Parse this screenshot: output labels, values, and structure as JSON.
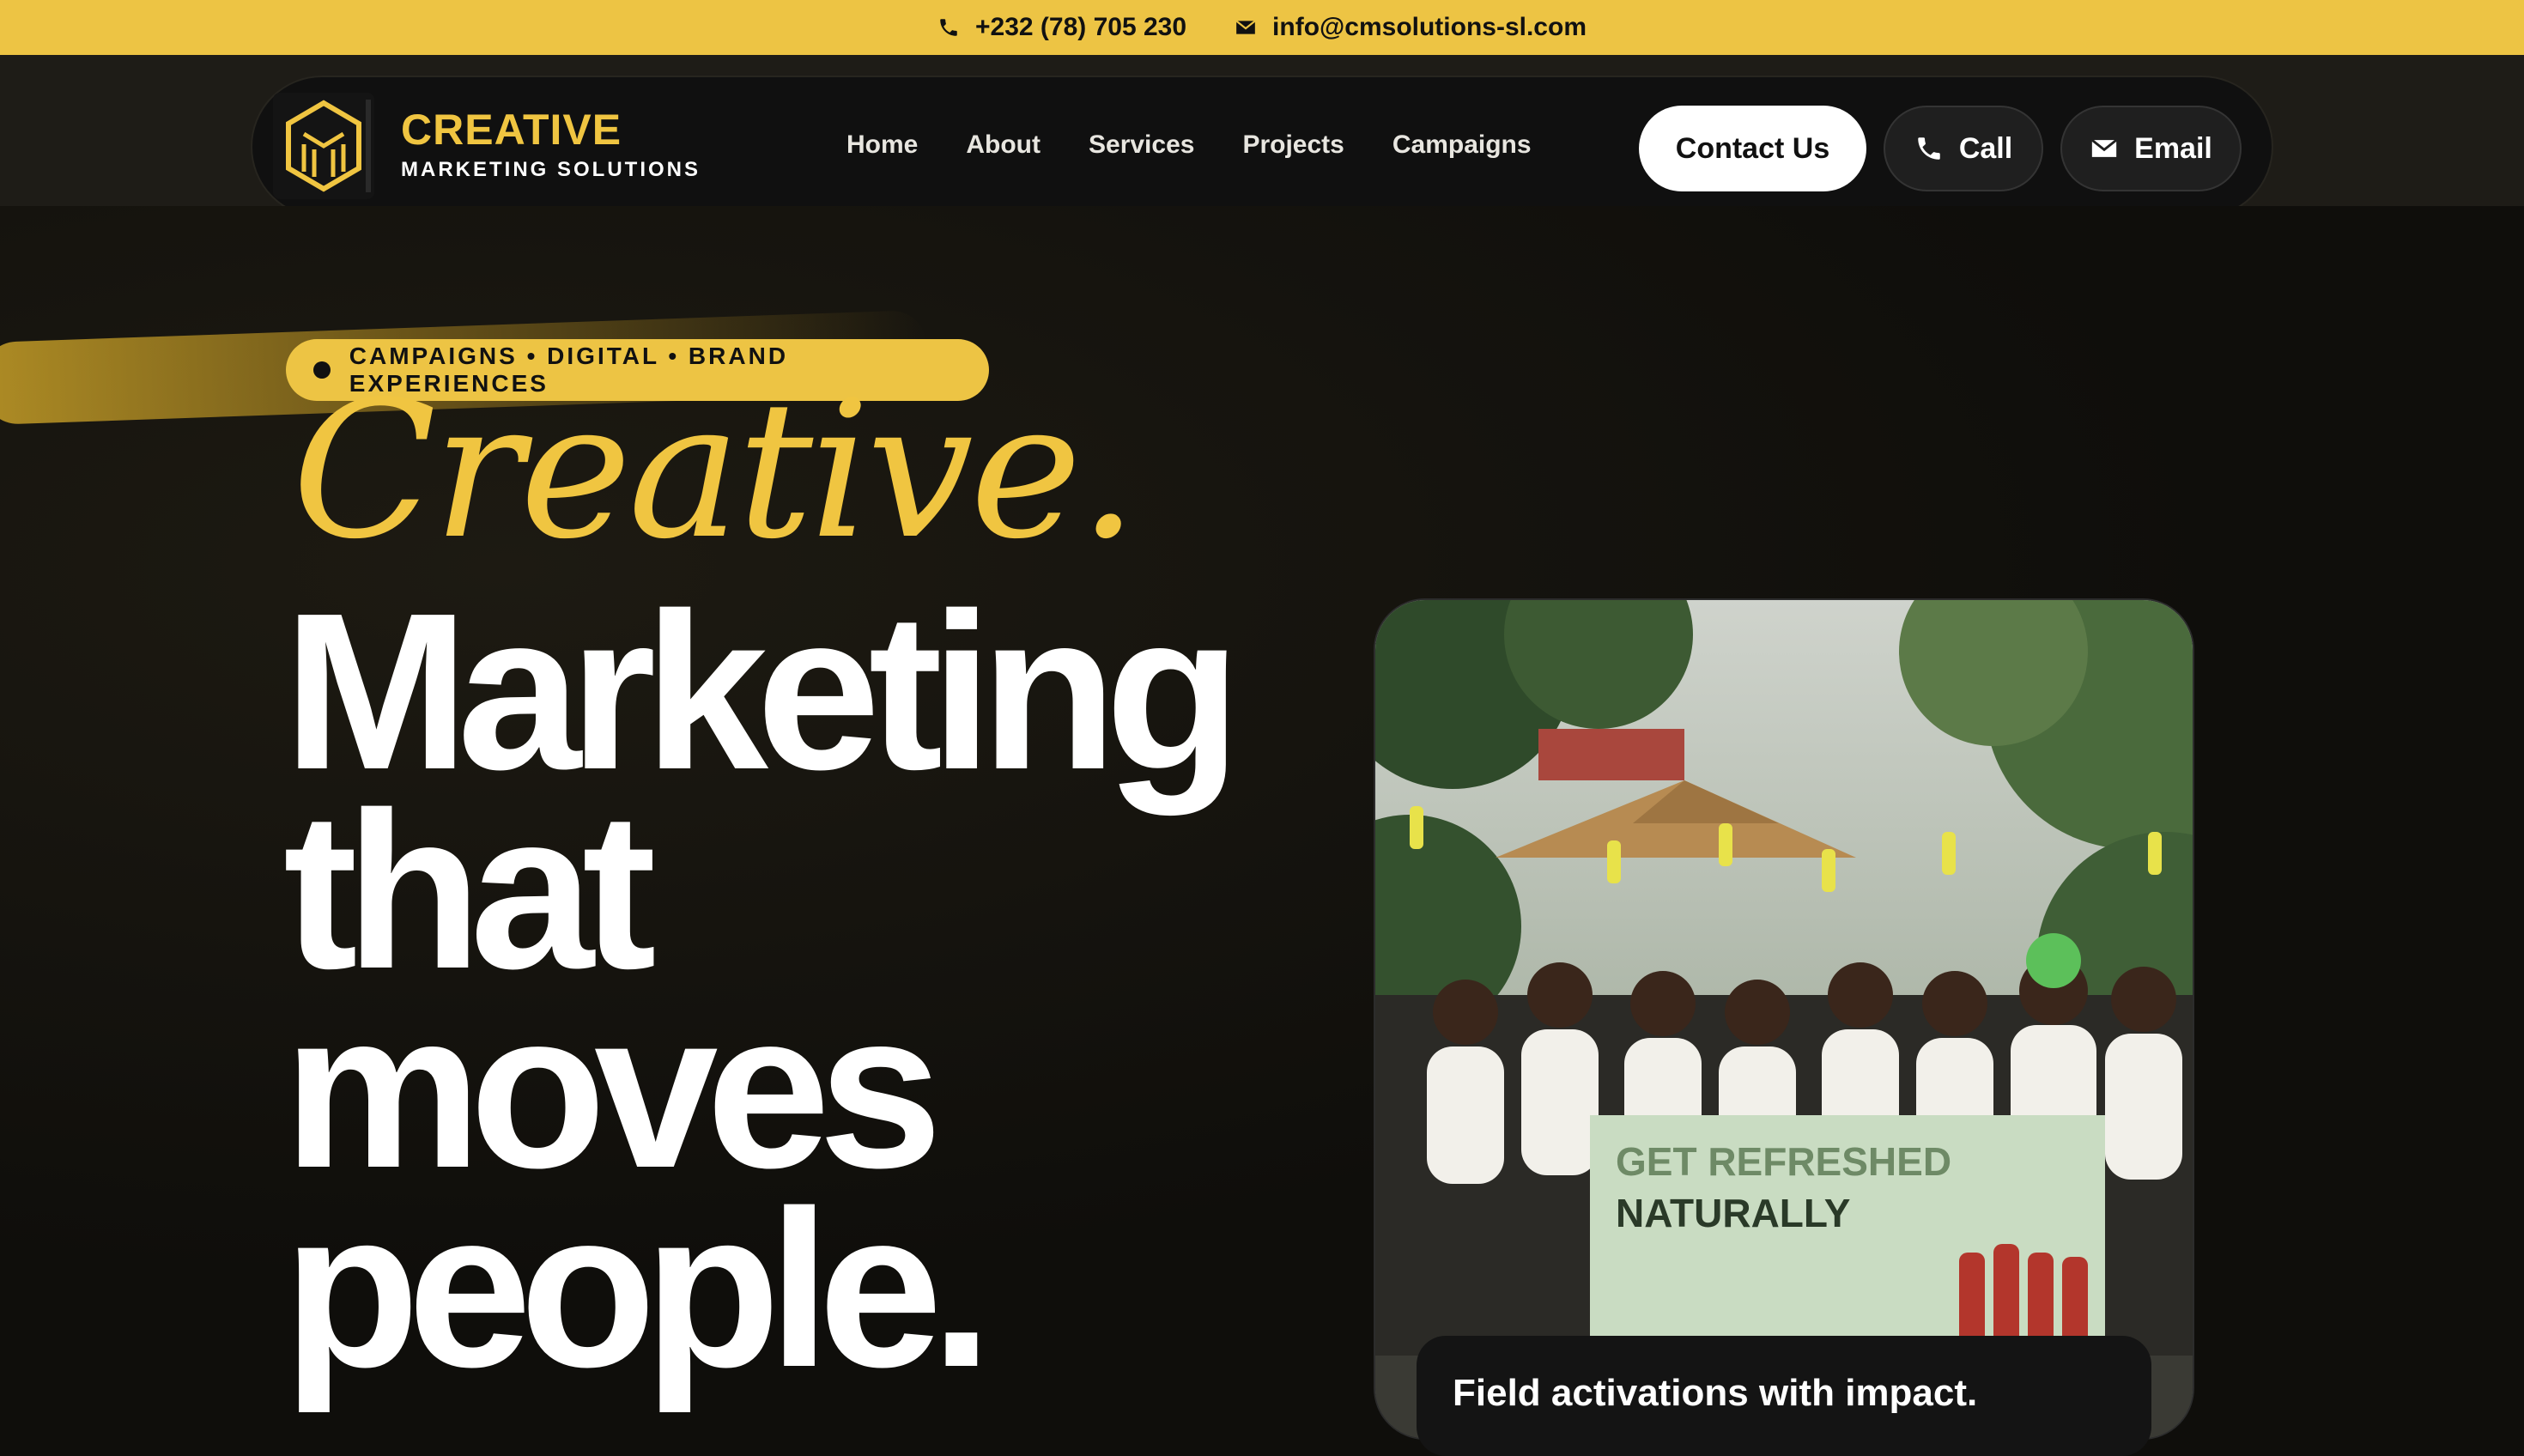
{
  "topbar": {
    "phone": "+232 (78) 705 230",
    "email": "info@cmsolutions-sl.com",
    "phone_icon": "phone-icon",
    "email_icon": "envelope-icon"
  },
  "brand": {
    "title": "CREATIVE",
    "subtitle": "MARKETING SOLUTIONS",
    "logo_icon": "cms-logo"
  },
  "nav": {
    "links": [
      "Home",
      "About",
      "Services",
      "Projects",
      "Campaigns"
    ]
  },
  "actions": {
    "contact_label": "Contact Us",
    "call_label": "Call",
    "email_label": "Email"
  },
  "hero": {
    "badge": "CAMPAIGNS • DIGITAL • BRAND EXPERIENCES",
    "script": "Creative.",
    "headline_lines": [
      "Marketing",
      "that",
      "moves",
      "people."
    ],
    "photo_banner_line1": "GET REFRESHED",
    "photo_banner_line2": "NATURALLY",
    "photo_caption": "Field activations with impact."
  },
  "colors": {
    "accent": "#edc444",
    "background": "#0f0e0b",
    "text": "#ffffff"
  }
}
